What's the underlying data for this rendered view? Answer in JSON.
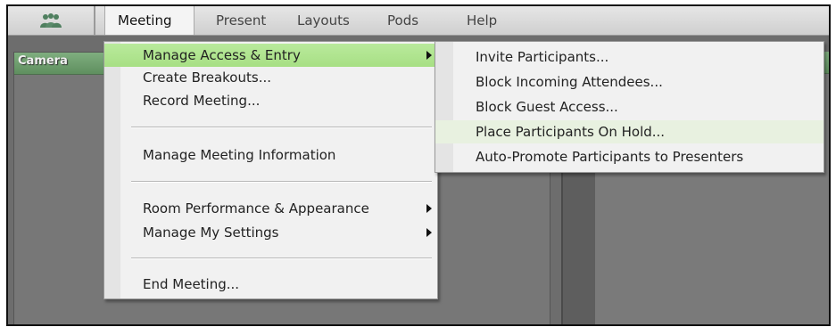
{
  "menubar": {
    "logo_icon": "adobe-connect-people-icon",
    "items": [
      {
        "label": "Meeting"
      },
      {
        "label": "Present"
      },
      {
        "label": "Layouts"
      },
      {
        "label": "Pods"
      },
      {
        "label": "Help"
      }
    ]
  },
  "pods": {
    "camera_title": "Camera"
  },
  "meeting_menu": {
    "items": [
      {
        "label": "Manage Access & Entry"
      },
      {
        "label": "Create Breakouts..."
      },
      {
        "label": "Record Meeting..."
      },
      {
        "label": "Manage Meeting Information"
      },
      {
        "label": "Room Performance & Appearance"
      },
      {
        "label": "Manage My Settings"
      },
      {
        "label": "End Meeting..."
      }
    ]
  },
  "access_submenu": {
    "items": [
      {
        "label": "Invite Participants..."
      },
      {
        "label": "Block Incoming Attendees..."
      },
      {
        "label": "Block Guest Access..."
      },
      {
        "label": "Place Participants On Hold..."
      },
      {
        "label": "Auto-Promote Participants to Presenters"
      }
    ]
  },
  "colors": {
    "highlight": "#a7df84",
    "pod_title": "#6f9f6f",
    "background": "#6d6d6d"
  }
}
